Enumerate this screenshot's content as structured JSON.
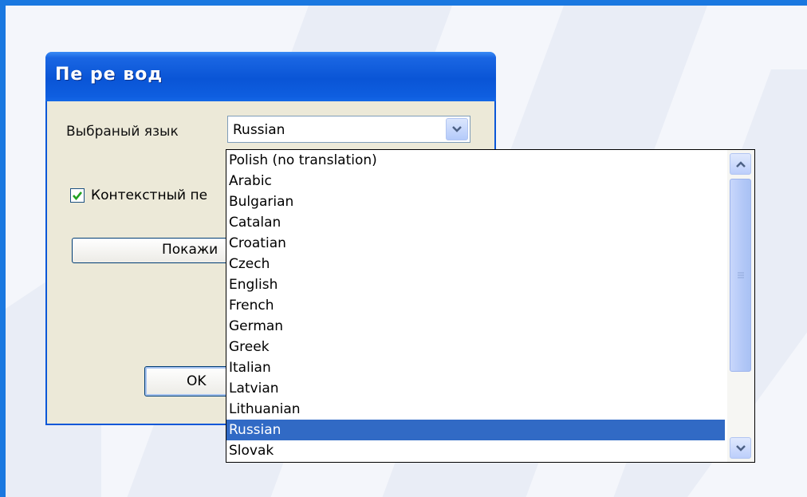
{
  "dialog": {
    "title": "Пе ре вод",
    "language_label": "Выбраный язык",
    "selected_language": "Russian",
    "context_checkbox_label": "Контекстный пе",
    "context_checked": true,
    "show_button_label": "Покажи",
    "ok_button_label": "OK"
  },
  "dropdown": {
    "items": [
      "Polish (no translation)",
      "Arabic",
      "Bulgarian",
      "Catalan",
      "Croatian",
      "Czech",
      "English",
      "French",
      "German",
      "Greek",
      "Italian",
      "Latvian",
      "Lithuanian",
      "Russian",
      "Slovak"
    ],
    "selected_index": 13
  },
  "colors": {
    "title_bar": "#0a55d6",
    "selection": "#316ac5",
    "frame": "#1a78e0"
  }
}
